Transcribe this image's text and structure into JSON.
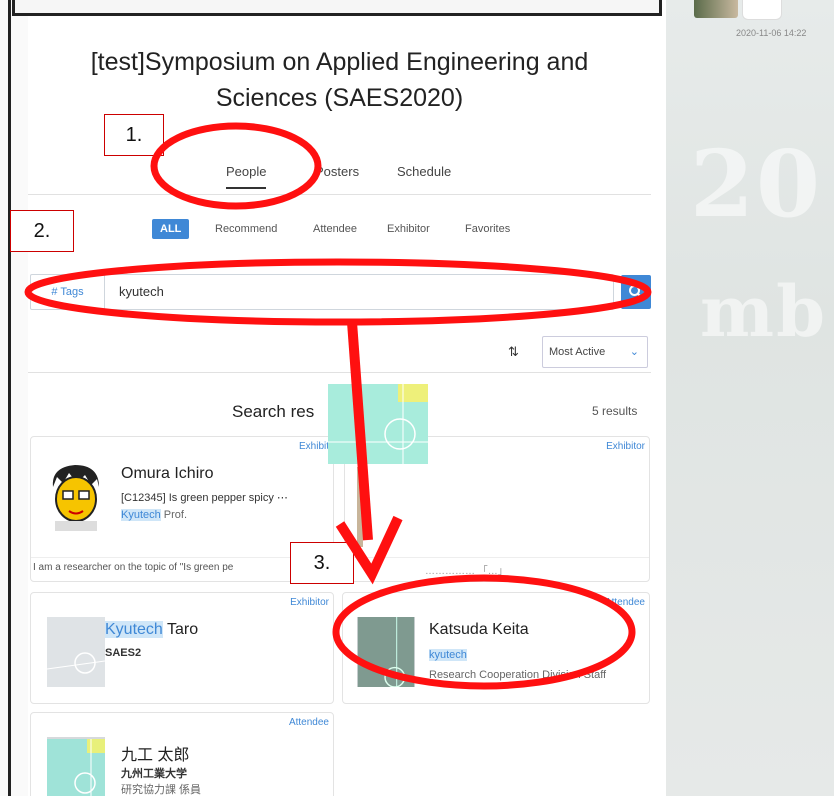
{
  "background": {
    "date": "2020-11-06 14:22"
  },
  "header": {
    "title_line1": "[test]Symposium on Applied Engineering and",
    "title_line2": "Sciences (SAES2020)"
  },
  "tabs": [
    "People",
    "Posters",
    "Schedule"
  ],
  "filters": [
    "ALL",
    "Recommend",
    "Attendee",
    "Exhibitor",
    "Favorites"
  ],
  "search": {
    "tags_label": "# Tags",
    "value": "kyutech",
    "button_icon": "search-icon"
  },
  "sort": {
    "label": "Most Active"
  },
  "results": {
    "heading": "Search res",
    "count": "5 results"
  },
  "cards": [
    {
      "badge": "Exhibit",
      "name": "Omura Ichiro",
      "line2": "[C12345] Is green pepper spicy ⋯",
      "line3_hl": "Kyutech",
      "line3_rest": " Prof.",
      "desc": "I am a researcher on the topic of \"Is green pe"
    },
    {
      "badge": "Exhibitor",
      "desc": "…………… 「…」"
    },
    {
      "badge": "Exhibitor",
      "name_hl": "Kyutech",
      "name_rest": " Taro",
      "line2": "SAES2"
    },
    {
      "badge": "Attendee",
      "name": "Katsuda Keita",
      "line2_hl": "kyutech",
      "line3": "Research Cooperation Division Staff"
    },
    {
      "badge": "Attendee",
      "name": "九工 太郎",
      "line2": "九州工業大学",
      "line3": "研究協力課 係員"
    }
  ],
  "annotations": [
    "1.",
    "2.",
    "3."
  ],
  "colors": {
    "accent": "#3f88d6",
    "annotation_red": "#ff1010"
  }
}
